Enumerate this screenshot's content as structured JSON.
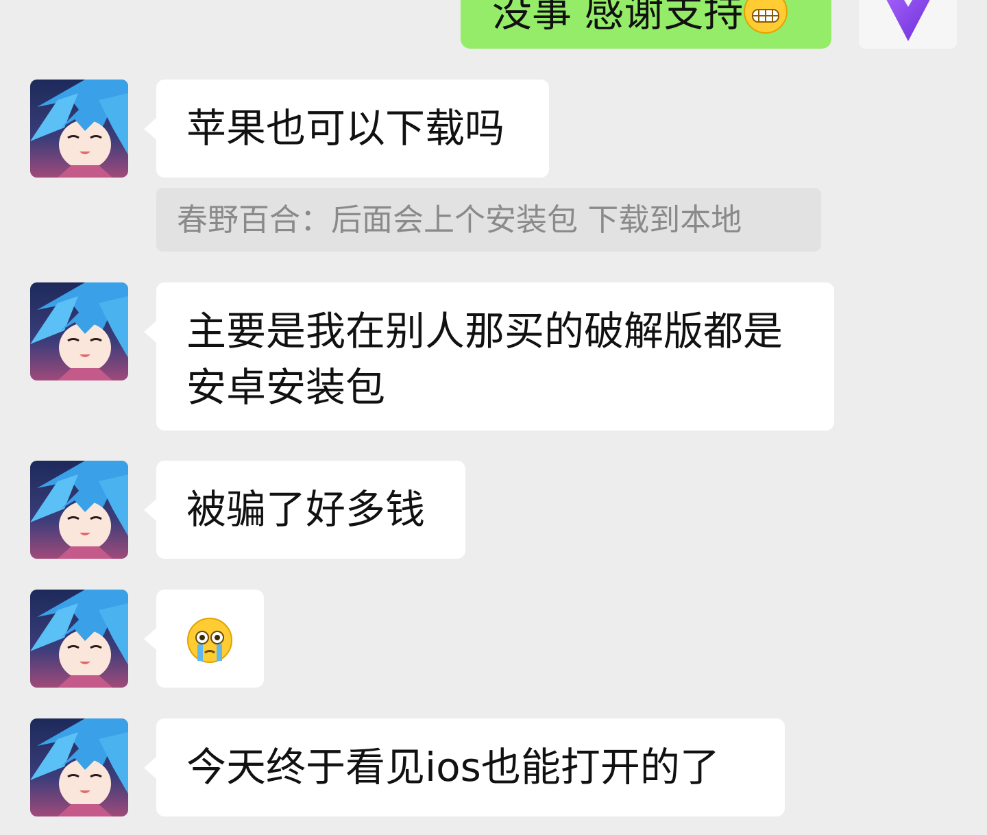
{
  "outgoing": {
    "text": "没事 感谢支持",
    "emoji": "grin-emoji"
  },
  "messages": [
    {
      "text": "苹果也可以下载吗"
    },
    {
      "quote": "春野百合：后面会上个安装包 下载到本地"
    },
    {
      "line1": "主要是我在别人那买的破解版都是",
      "line2": "安卓安装包"
    },
    {
      "text": "被骗了好多钱"
    },
    {
      "emoji": "crying-emoji"
    },
    {
      "text": "今天终于看见ios也能打开的了"
    }
  ],
  "avatar": {
    "icon": "anime-girl-avatar"
  },
  "my_avatar": {
    "icon": "purple-heart-avatar"
  },
  "colors": {
    "background": "#ededed",
    "incoming_bubble": "#ffffff",
    "outgoing_bubble": "#95ec69",
    "quote_bubble": "#e2e2e2",
    "quote_text": "#8a8a8a"
  }
}
